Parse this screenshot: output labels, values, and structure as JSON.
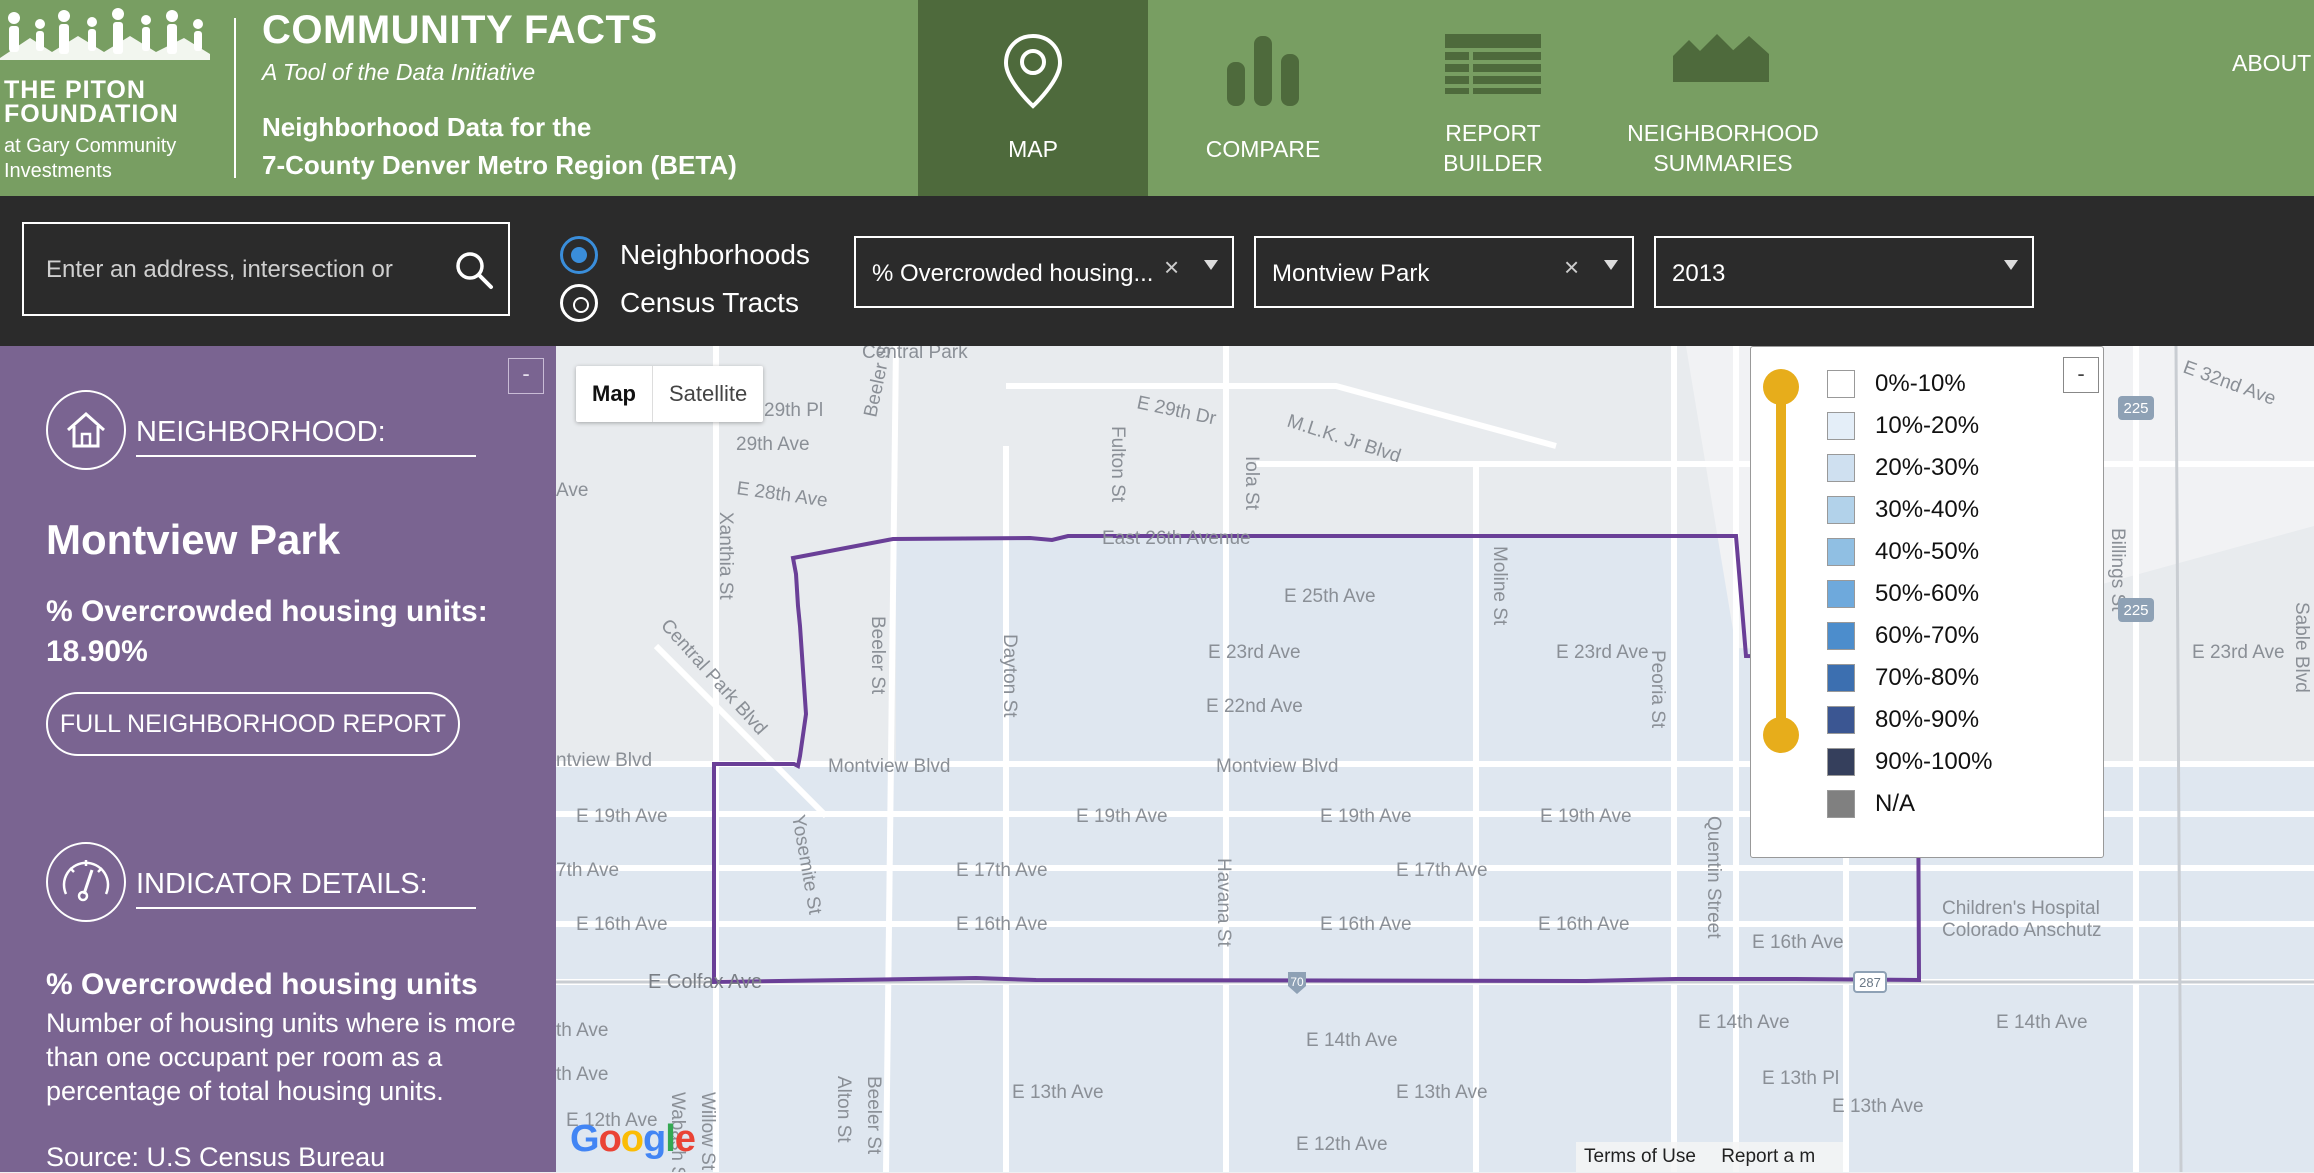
{
  "brand": {
    "org_line1": "THE PITON",
    "org_line2": "FOUNDATION",
    "org_line3": "at Gary Community",
    "org_line4": "Investments",
    "title": "COMMUNITY FACTS",
    "tagline": "A Tool of the Data Initiative",
    "subtitle_line1": "Neighborhood Data for the",
    "subtitle_line2": "7-County Denver Metro Region (BETA)"
  },
  "nav": {
    "map": "MAP",
    "compare": "COMPARE",
    "report_line1": "REPORT",
    "report_line2": "BUILDER",
    "summaries_line1": "NEIGHBORHOOD",
    "summaries_line2": "SUMMARIES",
    "about": "ABOUT"
  },
  "toolbar": {
    "search_placeholder": "Enter an address, intersection or",
    "radio_neighborhoods": "Neighborhoods",
    "radio_tracts": "Census Tracts",
    "indicator_value": "% Overcrowded housing...",
    "neighborhood_value": "Montview Park",
    "year_value": "2013",
    "clear_symbol": "×"
  },
  "panel": {
    "collapse": "-",
    "neighborhood_heading": "NEIGHBORHOOD:",
    "neighborhood_name": "Montview Park",
    "metric_label": "% Overcrowded housing units:",
    "metric_value": "18.90%",
    "report_button": "FULL NEIGHBORHOOD REPORT",
    "indicator_heading": "INDICATOR DETAILS:",
    "indicator_name": "% Overcrowded housing units",
    "indicator_description": "Number of housing units where is more than one occupant per room as a percentage of total housing units.",
    "indicator_source": "Source: U.S Census Bureau"
  },
  "map": {
    "map_button": "Map",
    "satellite_button": "Satellite",
    "google": [
      "G",
      "o",
      "o",
      "g",
      "l",
      "e"
    ],
    "google_colors": [
      "#4285f4",
      "#ea4335",
      "#fbbc05",
      "#4285f4",
      "#34a853",
      "#ea4335"
    ],
    "terms": "Terms of Use",
    "report": "Report a m",
    "streets": {
      "s1": "29th Pl",
      "s2": "29th Ave",
      "s3": "E 28th Ave",
      "s4": "E 29th Dr",
      "s5": "M.L.K. Jr Blvd",
      "s6": "East 26th Avenue",
      "s7": "E 25th Ave",
      "s8": "E 23rd Ave",
      "s9": "E 22nd Ave",
      "s10": "Montview Blvd",
      "s11": "E 19th Ave",
      "s12": "E 17th Ave",
      "s13": "E 16th Ave",
      "s14": "E Colfax Ave",
      "s15": "E 14th Ave",
      "s16": "E 13th Ave",
      "s17": "E 12th Ave",
      "s18": "Beeler St",
      "s19": "Fulton St",
      "s20": "Iola St",
      "s21": "Moline St",
      "s22": "Peoria St",
      "s23": "Dayton St",
      "s24": "Havana St",
      "s25": "Quentin Street",
      "s26": "Xanthia St",
      "s27": "Central Park Blvd",
      "s28": "Yosemite St",
      "s29": "Children's Hospital",
      "s30": "Colorado Anschutz",
      "s31": "E 32nd Ave",
      "s32": "Billings St",
      "s33": "Sable Blvd",
      "s34": "E 13th Pl",
      "s35": "Alton St",
      "s36": "Willow St",
      "s37": "Wabash St",
      "s38": "Central Park",
      "s39": "Ave",
      "s40": "ntview Blvd",
      "s41": "7th Ave",
      "s42": "th Ave",
      "s43": "225",
      "s44": "70",
      "s45": "287"
    },
    "legend": {
      "collapse": "-",
      "items": [
        {
          "label": "0%-10%",
          "color": "#ffffff"
        },
        {
          "label": "10%-20%",
          "color": "#e4eef8"
        },
        {
          "label": "20%-30%",
          "color": "#cfe0f0"
        },
        {
          "label": "30%-40%",
          "color": "#b2d2ea"
        },
        {
          "label": "40%-50%",
          "color": "#90bfe3"
        },
        {
          "label": "50%-60%",
          "color": "#6ea9dc"
        },
        {
          "label": "60%-70%",
          "color": "#4c8dcc"
        },
        {
          "label": "70%-80%",
          "color": "#3c6fb0"
        },
        {
          "label": "80%-90%",
          "color": "#3b5692"
        },
        {
          "label": "90%-100%",
          "color": "#353f5c"
        },
        {
          "label": "N/A",
          "color": "#808080"
        }
      ]
    }
  }
}
